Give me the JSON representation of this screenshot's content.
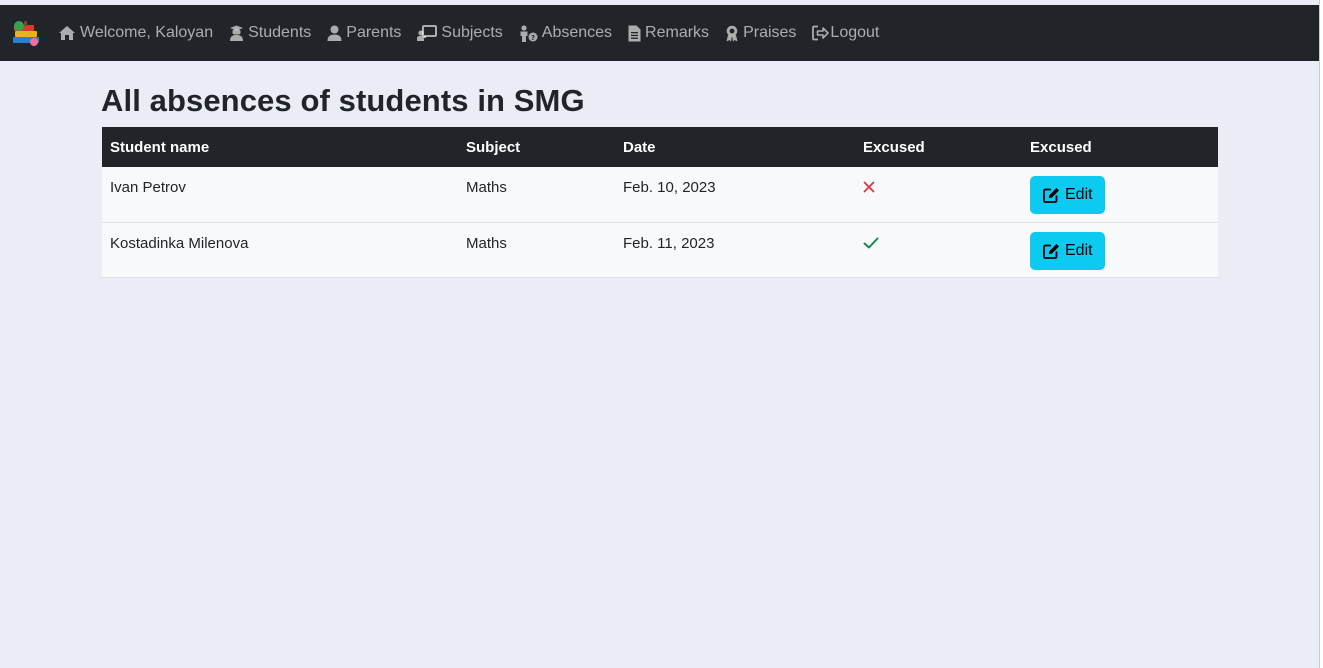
{
  "navbar": {
    "logo_icon": "school-books-icon",
    "items": [
      {
        "label": "Welcome, Kaloyan",
        "icon": "home-icon"
      },
      {
        "label": "Students",
        "icon": "graduate-icon"
      },
      {
        "label": "Parents",
        "icon": "user-icon"
      },
      {
        "label": "Subjects",
        "icon": "chalkboard-teacher-icon"
      },
      {
        "label": "Absences",
        "icon": "person-question-icon"
      },
      {
        "label": "Remarks",
        "icon": "file-text-icon"
      },
      {
        "label": "Praises",
        "icon": "award-icon"
      },
      {
        "label": "Logout",
        "icon": "sign-out-icon"
      }
    ]
  },
  "page_title": "All absences of students in SMG",
  "table": {
    "headers": [
      "Student name",
      "Subject",
      "Date",
      "Excused",
      "Excused"
    ],
    "rows": [
      {
        "student": "Ivan Petrov",
        "subject": "Maths",
        "date": "Feb. 10, 2023",
        "excused": false,
        "action": "Edit"
      },
      {
        "student": "Kostadinka Milenova",
        "subject": "Maths",
        "date": "Feb. 11, 2023",
        "excused": true,
        "action": "Edit"
      }
    ]
  },
  "colors": {
    "navbar_bg": "#212529",
    "page_bg": "#eaedf5",
    "edit_button": "#0dcaf0",
    "excused_true": "#198754",
    "excused_false": "#dc3545"
  }
}
